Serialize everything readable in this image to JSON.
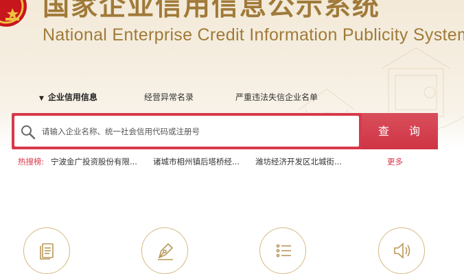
{
  "header": {
    "title_cn": "国家企业信用信息公示系统",
    "title_en": "National Enterprise Credit Information Publicity System"
  },
  "nav": {
    "items": [
      {
        "label": "企业信用信息",
        "active": true
      },
      {
        "label": "经营异常名录",
        "active": false
      },
      {
        "label": "严重违法失信企业名单",
        "active": false
      }
    ]
  },
  "search": {
    "placeholder": "请输入企业名称、统一社会信用代码或注册号",
    "button_label": "查 询"
  },
  "hot_search": {
    "label": "热搜榜:",
    "links": [
      "宁波金广投资股份有限...",
      "诸城市相州镇后塔桥经...",
      "潍坊经济开发区北城街..."
    ],
    "more_label": "更多"
  },
  "features": [
    {
      "icon": "document-icon"
    },
    {
      "icon": "pen-icon"
    },
    {
      "icon": "list-icon"
    },
    {
      "icon": "speaker-icon"
    }
  ],
  "colors": {
    "brand_gold": "#a07a39",
    "accent_red": "#d7394a",
    "banner_bg": "#f3ead9",
    "feature_border": "#d4b982"
  }
}
